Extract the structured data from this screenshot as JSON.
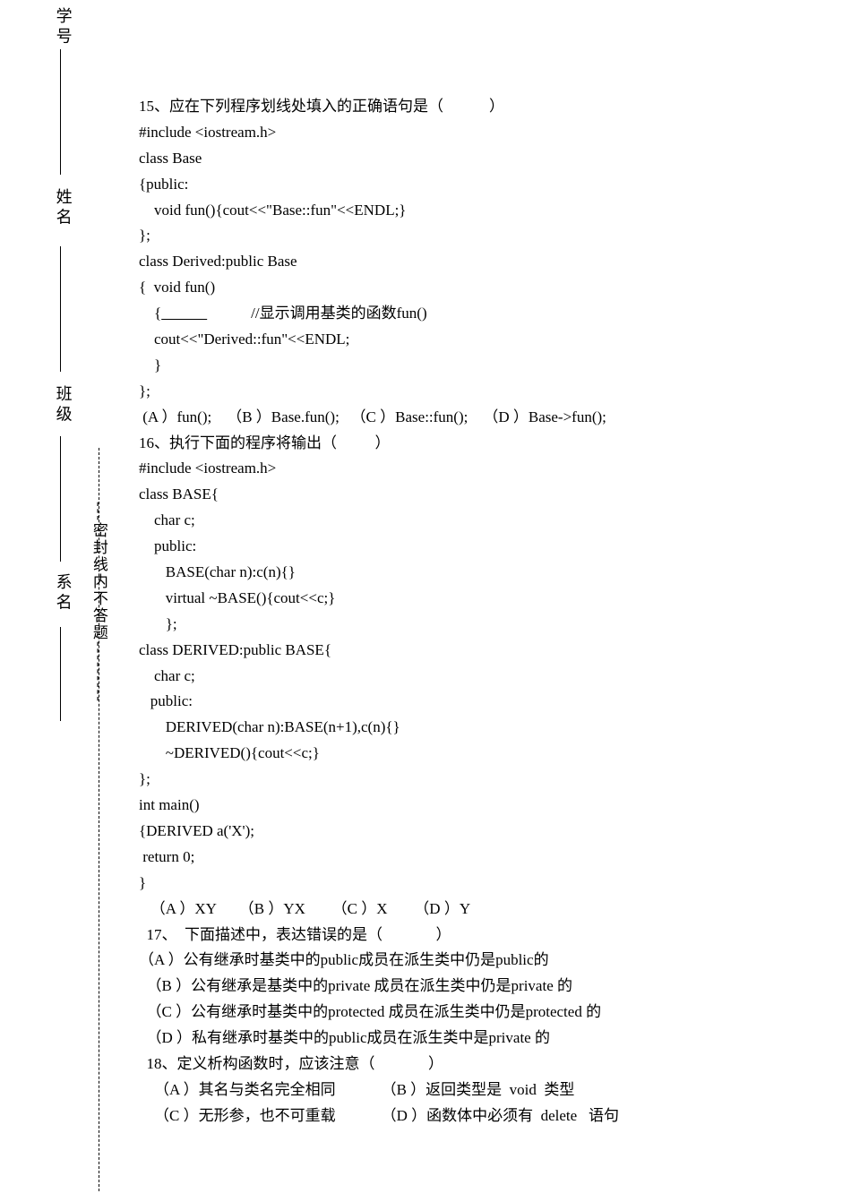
{
  "sidebar": {
    "xuehao": "学 号",
    "xingming": "姓 名",
    "banji": "班 级",
    "ximing": "系 名",
    "sealtext": "---密封线内不答题---------"
  },
  "q15": {
    "title": "15、应在下列程序划线处填入的正确语句是（            ）",
    "code1": "#include <iostream.h>",
    "code2": "class Base",
    "code3": "{public:",
    "code4": "    void fun(){cout<<\"Base::fun\"<<ENDL;}",
    "code5": "};",
    "code6": "class Derived:public Base",
    "code7": "{  void fun()",
    "code8_pre": "    {",
    "code8_post": "//显示调用基类的函数fun()",
    "code9": "    cout<<\"Derived::fun\"<<ENDL;",
    "code10": "    }",
    "code11": "};",
    "optA": " (A ）fun();",
    "optB": "（B ）Base.fun();",
    "optC": "（C ）Base::fun();",
    "optD": "（D ）Base->fun();"
  },
  "q16": {
    "title": "16、执行下面的程序将输出（          ）",
    "code1": "#include <iostream.h>",
    "code2": "class BASE{",
    "code3": "    char c;",
    "code4": "    public:",
    "code5": "       BASE(char n):c(n){}",
    "code6": "       virtual ~BASE(){cout<<c;}",
    "code7": "       };",
    "code8": "class DERIVED:public BASE{",
    "code9": "    char c;",
    "code10": "   public:",
    "code11": "       DERIVED(char n):BASE(n+1),c(n){}",
    "code12": "       ~DERIVED(){cout<<c;}",
    "code13": "};",
    "code14": "int main()",
    "code15": "{DERIVED a('X');",
    "code16": " return 0;",
    "code17": "}",
    "optA": "   （A ）XY",
    "optB": "（B ）YX",
    "optC": "（C ）X",
    "optD": "（D ）Y"
  },
  "q17": {
    "title": "  17、  下面描述中，表达错误的是（              ）",
    "optA": "（A ）公有继承时基类中的public成员在派生类中仍是public的",
    "optB": "  （B ）公有继承是基类中的private 成员在派生类中仍是private 的",
    "optC": "  （C ）公有继承时基类中的protected 成员在派生类中仍是protected 的",
    "optD": "  （D ）私有继承时基类中的public成员在派生类中是private 的"
  },
  "q18": {
    "title": "  18、定义析构函数时，应该注意（              ）",
    "optA": "    （A ）其名与类名完全相同",
    "optB": "（B ）返回类型是  void  类型",
    "optC": "    （C ）无形参，也不可重载",
    "optD": "（D ）函数体中必须有  delete   语句"
  }
}
